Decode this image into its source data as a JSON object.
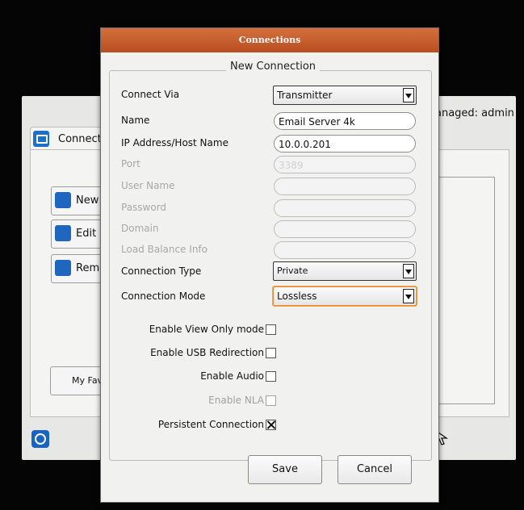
{
  "background": {
    "managed_text": "anaged: admin",
    "tab_label": "Connecti",
    "buttons": [
      {
        "label": "New",
        "icon": "new-connection-icon"
      },
      {
        "label": "Edit",
        "icon": "gear-icon"
      },
      {
        "label": "Remo",
        "icon": "trash-icon"
      }
    ],
    "favorites_label": "My Fav",
    "info_icon": "info-icon"
  },
  "dialog": {
    "title": "Connections",
    "group_title": "New Connection",
    "fields": {
      "connect_via": {
        "label": "Connect Via",
        "value": "Transmitter"
      },
      "name": {
        "label": "Name",
        "value": "Email Server 4k"
      },
      "ip": {
        "label": "IP Address/Host Name",
        "value": "10.0.0.201"
      },
      "port": {
        "label": "Port",
        "value": "3389"
      },
      "user_name": {
        "label": "User Name",
        "value": ""
      },
      "password": {
        "label": "Password",
        "value": ""
      },
      "domain": {
        "label": "Domain",
        "value": ""
      },
      "load_balance": {
        "label": "Load Balance Info",
        "value": ""
      },
      "connection_type": {
        "label": "Connection Type",
        "value": "Private"
      },
      "connection_mode": {
        "label": "Connection Mode",
        "value": "Lossless"
      }
    },
    "options": {
      "view_only": {
        "label": "Enable View Only mode",
        "checked": false
      },
      "usb": {
        "label": "Enable USB Redirection",
        "checked": false
      },
      "audio": {
        "label": "Enable Audio",
        "checked": false
      },
      "nla": {
        "label": "Enable NLA",
        "checked": false,
        "disabled": true
      },
      "persistent": {
        "label": "Persistent Connection",
        "checked": true
      }
    },
    "save_label": "Save",
    "cancel_label": "Cancel"
  },
  "colors": {
    "titlebar": "#c85e2e",
    "accent_focus": "#e88a33"
  }
}
